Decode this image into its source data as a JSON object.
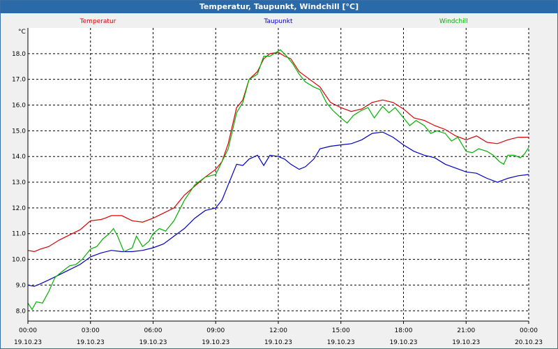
{
  "window": {
    "title": "Temperatur, Taupunkt, Windchill [°C]"
  },
  "chart_data": {
    "type": "line",
    "unit": "°C",
    "ylim": [
      7.6,
      19.0
    ],
    "yticks": [
      "8.0",
      "9.0",
      "10.0",
      "11.0",
      "12.0",
      "13.0",
      "14.0",
      "15.0",
      "16.0",
      "17.0",
      "18.0"
    ],
    "xticks": [
      {
        "time": "00:00",
        "date": "19.10.23"
      },
      {
        "time": "03:00",
        "date": "19.10.23"
      },
      {
        "time": "06:00",
        "date": "19.10.23"
      },
      {
        "time": "09:00",
        "date": "19.10.23"
      },
      {
        "time": "12:00",
        "date": "19.10.23"
      },
      {
        "time": "15:00",
        "date": "19.10.23"
      },
      {
        "time": "18:00",
        "date": "19.10.23"
      },
      {
        "time": "21:00",
        "date": "19.10.23"
      },
      {
        "time": "00:00",
        "date": "20.10.23"
      }
    ],
    "xlim_hours": [
      0,
      24
    ],
    "grid": true,
    "series": [
      {
        "name": "Temperatur",
        "color": "#dd0000",
        "points": [
          [
            0,
            10.35
          ],
          [
            0.3,
            10.3
          ],
          [
            0.6,
            10.4
          ],
          [
            1,
            10.5
          ],
          [
            1.5,
            10.75
          ],
          [
            2,
            10.95
          ],
          [
            2.5,
            11.15
          ],
          [
            3,
            11.5
          ],
          [
            3.5,
            11.55
          ],
          [
            3.7,
            11.6
          ],
          [
            4,
            11.7
          ],
          [
            4.5,
            11.7
          ],
          [
            5,
            11.5
          ],
          [
            5.5,
            11.45
          ],
          [
            6,
            11.6
          ],
          [
            6.5,
            11.8
          ],
          [
            7,
            12.0
          ],
          [
            7.5,
            12.5
          ],
          [
            8,
            12.85
          ],
          [
            8.5,
            13.2
          ],
          [
            9,
            13.5
          ],
          [
            9.3,
            13.8
          ],
          [
            9.6,
            14.5
          ],
          [
            10,
            15.9
          ],
          [
            10.3,
            16.2
          ],
          [
            10.6,
            17.0
          ],
          [
            11,
            17.3
          ],
          [
            11.3,
            17.8
          ],
          [
            11.6,
            18.0
          ],
          [
            12,
            18.05
          ],
          [
            12.3,
            17.9
          ],
          [
            12.6,
            17.8
          ],
          [
            13,
            17.3
          ],
          [
            13.5,
            17.0
          ],
          [
            14,
            16.7
          ],
          [
            14.5,
            16.1
          ],
          [
            15,
            15.9
          ],
          [
            15.5,
            15.75
          ],
          [
            16,
            15.85
          ],
          [
            16.5,
            16.1
          ],
          [
            17,
            16.2
          ],
          [
            17.5,
            16.1
          ],
          [
            18,
            15.85
          ],
          [
            18.5,
            15.5
          ],
          [
            19,
            15.4
          ],
          [
            19.5,
            15.2
          ],
          [
            20,
            15.05
          ],
          [
            20.5,
            14.8
          ],
          [
            21,
            14.65
          ],
          [
            21.5,
            14.8
          ],
          [
            22,
            14.55
          ],
          [
            22.5,
            14.5
          ],
          [
            23,
            14.65
          ],
          [
            23.5,
            14.75
          ],
          [
            24,
            14.75
          ]
        ]
      },
      {
        "name": "Taupunkt",
        "color": "#0000c0",
        "points": [
          [
            0,
            9.0
          ],
          [
            0.3,
            8.95
          ],
          [
            0.6,
            9.05
          ],
          [
            1,
            9.2
          ],
          [
            1.5,
            9.4
          ],
          [
            2,
            9.6
          ],
          [
            2.5,
            9.8
          ],
          [
            3,
            10.1
          ],
          [
            3.5,
            10.25
          ],
          [
            4,
            10.35
          ],
          [
            4.5,
            10.3
          ],
          [
            5,
            10.3
          ],
          [
            5.5,
            10.35
          ],
          [
            6,
            10.45
          ],
          [
            6.5,
            10.6
          ],
          [
            7,
            10.9
          ],
          [
            7.5,
            11.2
          ],
          [
            8,
            11.6
          ],
          [
            8.5,
            11.9
          ],
          [
            9,
            12.0
          ],
          [
            9.3,
            12.3
          ],
          [
            9.6,
            12.9
          ],
          [
            10,
            13.7
          ],
          [
            10.3,
            13.65
          ],
          [
            10.6,
            13.9
          ],
          [
            11,
            14.05
          ],
          [
            11.3,
            13.65
          ],
          [
            11.6,
            14.05
          ],
          [
            12,
            14.0
          ],
          [
            12.3,
            13.9
          ],
          [
            12.6,
            13.7
          ],
          [
            13,
            13.5
          ],
          [
            13.3,
            13.6
          ],
          [
            13.7,
            13.9
          ],
          [
            14,
            14.3
          ],
          [
            14.5,
            14.4
          ],
          [
            15,
            14.45
          ],
          [
            15.5,
            14.5
          ],
          [
            16,
            14.65
          ],
          [
            16.5,
            14.9
          ],
          [
            17,
            14.95
          ],
          [
            17.5,
            14.75
          ],
          [
            18,
            14.45
          ],
          [
            18.5,
            14.2
          ],
          [
            19,
            14.05
          ],
          [
            19.5,
            13.95
          ],
          [
            20,
            13.7
          ],
          [
            20.5,
            13.55
          ],
          [
            21,
            13.4
          ],
          [
            21.5,
            13.35
          ],
          [
            22,
            13.15
          ],
          [
            22.5,
            13.0
          ],
          [
            23,
            13.15
          ],
          [
            23.5,
            13.25
          ],
          [
            24,
            13.3
          ]
        ]
      },
      {
        "name": "Windchill",
        "color": "#00b000",
        "points": [
          [
            0,
            8.3
          ],
          [
            0.2,
            8.05
          ],
          [
            0.4,
            8.35
          ],
          [
            0.7,
            8.3
          ],
          [
            1,
            8.75
          ],
          [
            1.3,
            9.3
          ],
          [
            1.6,
            9.5
          ],
          [
            2,
            9.75
          ],
          [
            2.3,
            9.8
          ],
          [
            2.6,
            10.0
          ],
          [
            3,
            10.4
          ],
          [
            3.3,
            10.5
          ],
          [
            3.6,
            10.8
          ],
          [
            3.9,
            11.0
          ],
          [
            4.1,
            11.2
          ],
          [
            4.3,
            10.9
          ],
          [
            4.6,
            10.3
          ],
          [
            5,
            10.45
          ],
          [
            5.2,
            10.9
          ],
          [
            5.5,
            10.5
          ],
          [
            5.8,
            10.7
          ],
          [
            6,
            11.0
          ],
          [
            6.3,
            11.2
          ],
          [
            6.6,
            11.1
          ],
          [
            7,
            11.5
          ],
          [
            7.5,
            12.3
          ],
          [
            8,
            12.9
          ],
          [
            8.5,
            13.2
          ],
          [
            9,
            13.3
          ],
          [
            9.3,
            13.8
          ],
          [
            9.6,
            14.3
          ],
          [
            10,
            15.7
          ],
          [
            10.3,
            16.1
          ],
          [
            10.6,
            17.0
          ],
          [
            11,
            17.2
          ],
          [
            11.3,
            17.9
          ],
          [
            11.6,
            17.9
          ],
          [
            11.9,
            18.05
          ],
          [
            12.1,
            18.15
          ],
          [
            12.4,
            17.9
          ],
          [
            12.7,
            17.6
          ],
          [
            13,
            17.2
          ],
          [
            13.3,
            16.9
          ],
          [
            13.7,
            16.7
          ],
          [
            14,
            16.6
          ],
          [
            14.3,
            16.1
          ],
          [
            14.6,
            15.8
          ],
          [
            15,
            15.5
          ],
          [
            15.3,
            15.3
          ],
          [
            15.6,
            15.6
          ],
          [
            16,
            15.8
          ],
          [
            16.3,
            15.9
          ],
          [
            16.6,
            15.5
          ],
          [
            17,
            15.95
          ],
          [
            17.3,
            15.7
          ],
          [
            17.6,
            15.9
          ],
          [
            18,
            15.5
          ],
          [
            18.3,
            15.2
          ],
          [
            18.6,
            15.4
          ],
          [
            19,
            15.2
          ],
          [
            19.3,
            14.9
          ],
          [
            19.6,
            15.0
          ],
          [
            20,
            14.9
          ],
          [
            20.3,
            14.6
          ],
          [
            20.6,
            14.75
          ],
          [
            21,
            14.2
          ],
          [
            21.3,
            14.15
          ],
          [
            21.6,
            14.3
          ],
          [
            22,
            14.2
          ],
          [
            22.3,
            14.05
          ],
          [
            22.6,
            13.8
          ],
          [
            22.8,
            13.7
          ],
          [
            23,
            14.05
          ],
          [
            23.3,
            14.05
          ],
          [
            23.6,
            13.95
          ],
          [
            23.8,
            14.1
          ],
          [
            24,
            14.35
          ]
        ]
      }
    ]
  }
}
